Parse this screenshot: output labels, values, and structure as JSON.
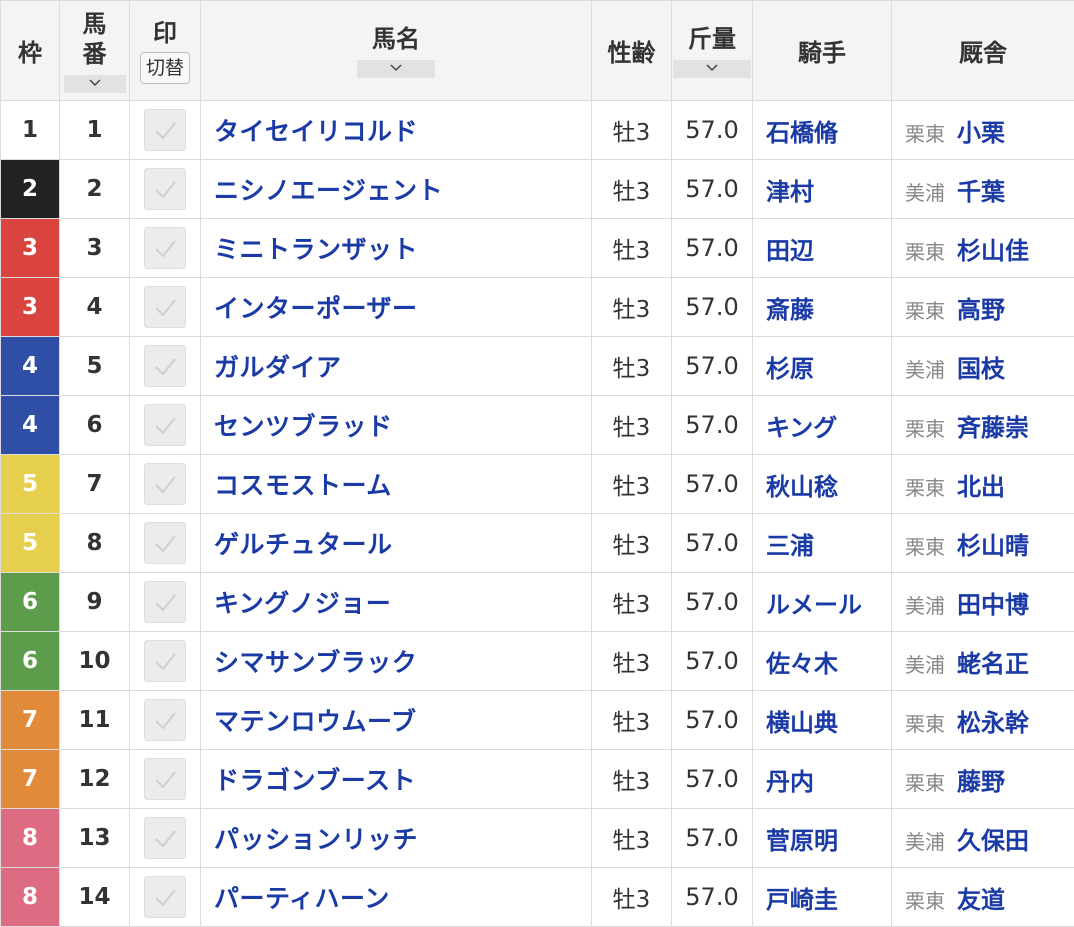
{
  "headers": {
    "waku": "枠",
    "umaban_top": "馬",
    "umaban_bottom": "番",
    "mark": "印",
    "mark_toggle": "切替",
    "horse": "馬名",
    "sex_age": "性齢",
    "weight": "斤量",
    "jockey": "騎手",
    "stable": "厩舎"
  },
  "icons": {
    "sort": "chevron-down-icon",
    "mark": "checkmark-icon"
  },
  "frame_colors": {
    "1": {
      "bg": "#ffffff",
      "fg": "#333333"
    },
    "2": {
      "bg": "#222222",
      "fg": "#ffffff"
    },
    "3": {
      "bg": "#d9443f",
      "fg": "#ffffff"
    },
    "4": {
      "bg": "#2f4fa6",
      "fg": "#ffffff"
    },
    "5": {
      "bg": "#e6cf4c",
      "fg": "#ffffff"
    },
    "6": {
      "bg": "#5d9c4a",
      "fg": "#ffffff"
    },
    "7": {
      "bg": "#e08a3a",
      "fg": "#ffffff"
    },
    "8": {
      "bg": "#dd6b82",
      "fg": "#ffffff"
    }
  },
  "rows": [
    {
      "waku": "1",
      "umaban": "1",
      "horse": "タイセイリコルド",
      "sex_age": "牡3",
      "weight": "57.0",
      "jockey": "石橋脩",
      "region": "栗東",
      "trainer": "小栗"
    },
    {
      "waku": "2",
      "umaban": "2",
      "horse": "ニシノエージェント",
      "sex_age": "牡3",
      "weight": "57.0",
      "jockey": "津村",
      "region": "美浦",
      "trainer": "千葉"
    },
    {
      "waku": "3",
      "umaban": "3",
      "horse": "ミニトランザット",
      "sex_age": "牡3",
      "weight": "57.0",
      "jockey": "田辺",
      "region": "栗東",
      "trainer": "杉山佳"
    },
    {
      "waku": "3",
      "umaban": "4",
      "horse": "インターポーザー",
      "sex_age": "牡3",
      "weight": "57.0",
      "jockey": "斎藤",
      "region": "栗東",
      "trainer": "高野"
    },
    {
      "waku": "4",
      "umaban": "5",
      "horse": "ガルダイア",
      "sex_age": "牡3",
      "weight": "57.0",
      "jockey": "杉原",
      "region": "美浦",
      "trainer": "国枝"
    },
    {
      "waku": "4",
      "umaban": "6",
      "horse": "センツブラッド",
      "sex_age": "牡3",
      "weight": "57.0",
      "jockey": "キング",
      "region": "栗東",
      "trainer": "斉藤崇"
    },
    {
      "waku": "5",
      "umaban": "7",
      "horse": "コスモストーム",
      "sex_age": "牡3",
      "weight": "57.0",
      "jockey": "秋山稔",
      "region": "栗東",
      "trainer": "北出"
    },
    {
      "waku": "5",
      "umaban": "8",
      "horse": "ゲルチュタール",
      "sex_age": "牡3",
      "weight": "57.0",
      "jockey": "三浦",
      "region": "栗東",
      "trainer": "杉山晴"
    },
    {
      "waku": "6",
      "umaban": "9",
      "horse": "キングノジョー",
      "sex_age": "牡3",
      "weight": "57.0",
      "jockey": "ルメール",
      "region": "美浦",
      "trainer": "田中博"
    },
    {
      "waku": "6",
      "umaban": "10",
      "horse": "シマサンブラック",
      "sex_age": "牡3",
      "weight": "57.0",
      "jockey": "佐々木",
      "region": "美浦",
      "trainer": "蛯名正"
    },
    {
      "waku": "7",
      "umaban": "11",
      "horse": "マテンロウムーブ",
      "sex_age": "牡3",
      "weight": "57.0",
      "jockey": "横山典",
      "region": "栗東",
      "trainer": "松永幹"
    },
    {
      "waku": "7",
      "umaban": "12",
      "horse": "ドラゴンブースト",
      "sex_age": "牡3",
      "weight": "57.0",
      "jockey": "丹内",
      "region": "栗東",
      "trainer": "藤野"
    },
    {
      "waku": "8",
      "umaban": "13",
      "horse": "パッションリッチ",
      "sex_age": "牡3",
      "weight": "57.0",
      "jockey": "菅原明",
      "region": "美浦",
      "trainer": "久保田"
    },
    {
      "waku": "8",
      "umaban": "14",
      "horse": "パーティハーン",
      "sex_age": "牡3",
      "weight": "57.0",
      "jockey": "戸崎圭",
      "region": "栗東",
      "trainer": "友道"
    }
  ]
}
